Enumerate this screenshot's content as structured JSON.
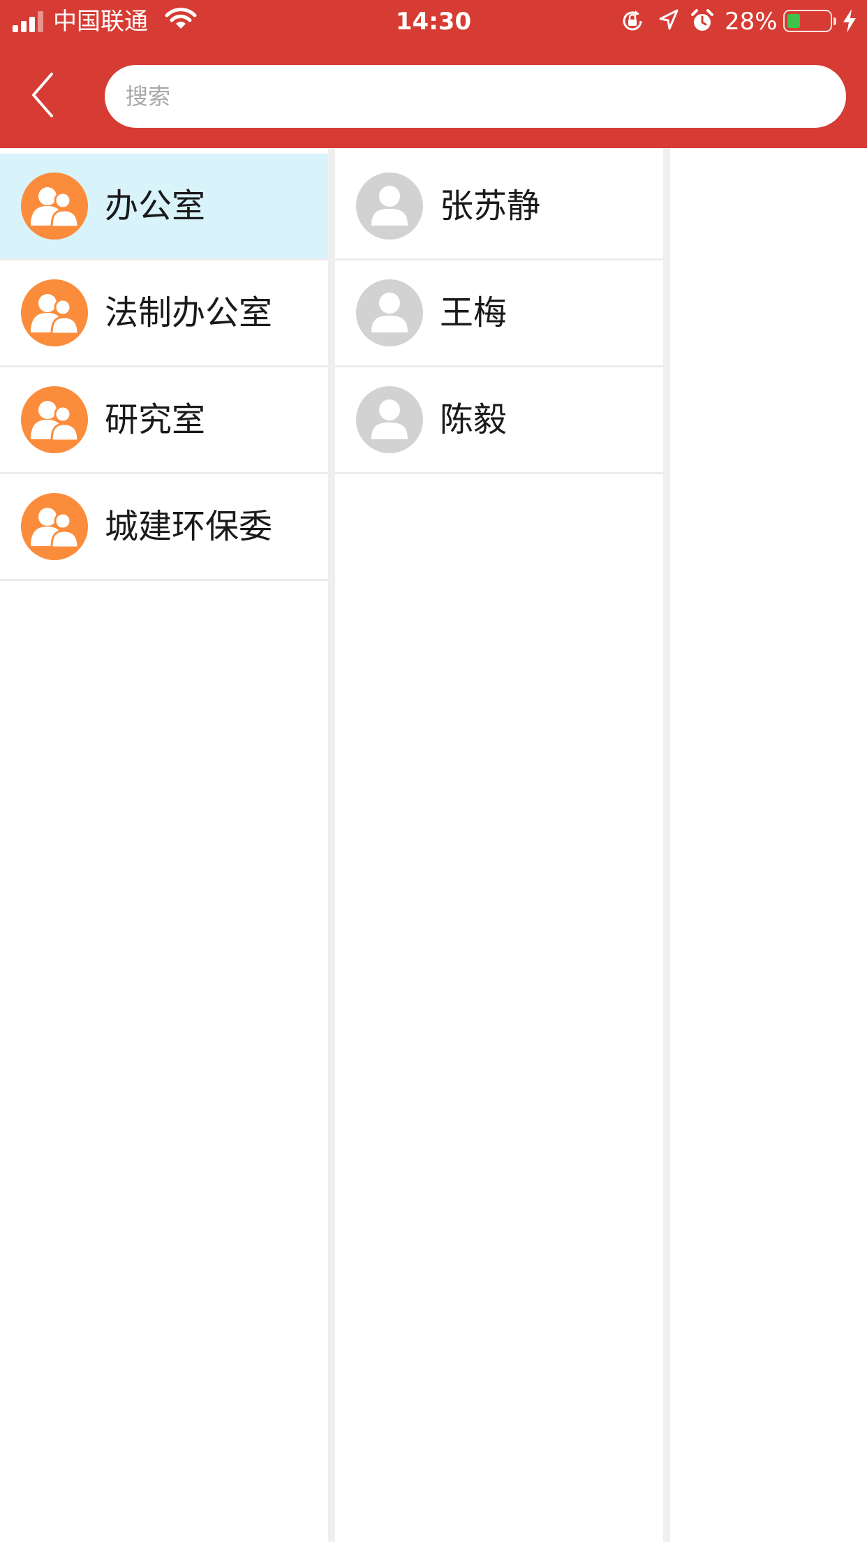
{
  "status_bar": {
    "carrier": "中国联通",
    "time": "14:30",
    "battery_percent": "28%",
    "battery_level": 0.28,
    "icons": [
      "signal-icon",
      "wifi-icon",
      "rotation-lock-icon",
      "location-icon",
      "alarm-icon",
      "battery-icon",
      "charging-icon"
    ]
  },
  "header": {
    "back_icon": "chevron-left-icon",
    "search": {
      "placeholder": "搜索",
      "value": ""
    }
  },
  "departments": [
    {
      "label": "办公室",
      "selected": true
    },
    {
      "label": "法制办公室",
      "selected": false
    },
    {
      "label": "研究室",
      "selected": false
    },
    {
      "label": "城建环保委",
      "selected": false
    }
  ],
  "members": [
    {
      "label": "张苏静"
    },
    {
      "label": "王梅"
    },
    {
      "label": "陈毅"
    }
  ],
  "colors": {
    "header_red": "#d63c33",
    "org_avatar": "#fb8c3c",
    "person_avatar": "#d2d2d2",
    "selected_row": "#d9f3fb",
    "battery_green": "#3ec24b"
  }
}
